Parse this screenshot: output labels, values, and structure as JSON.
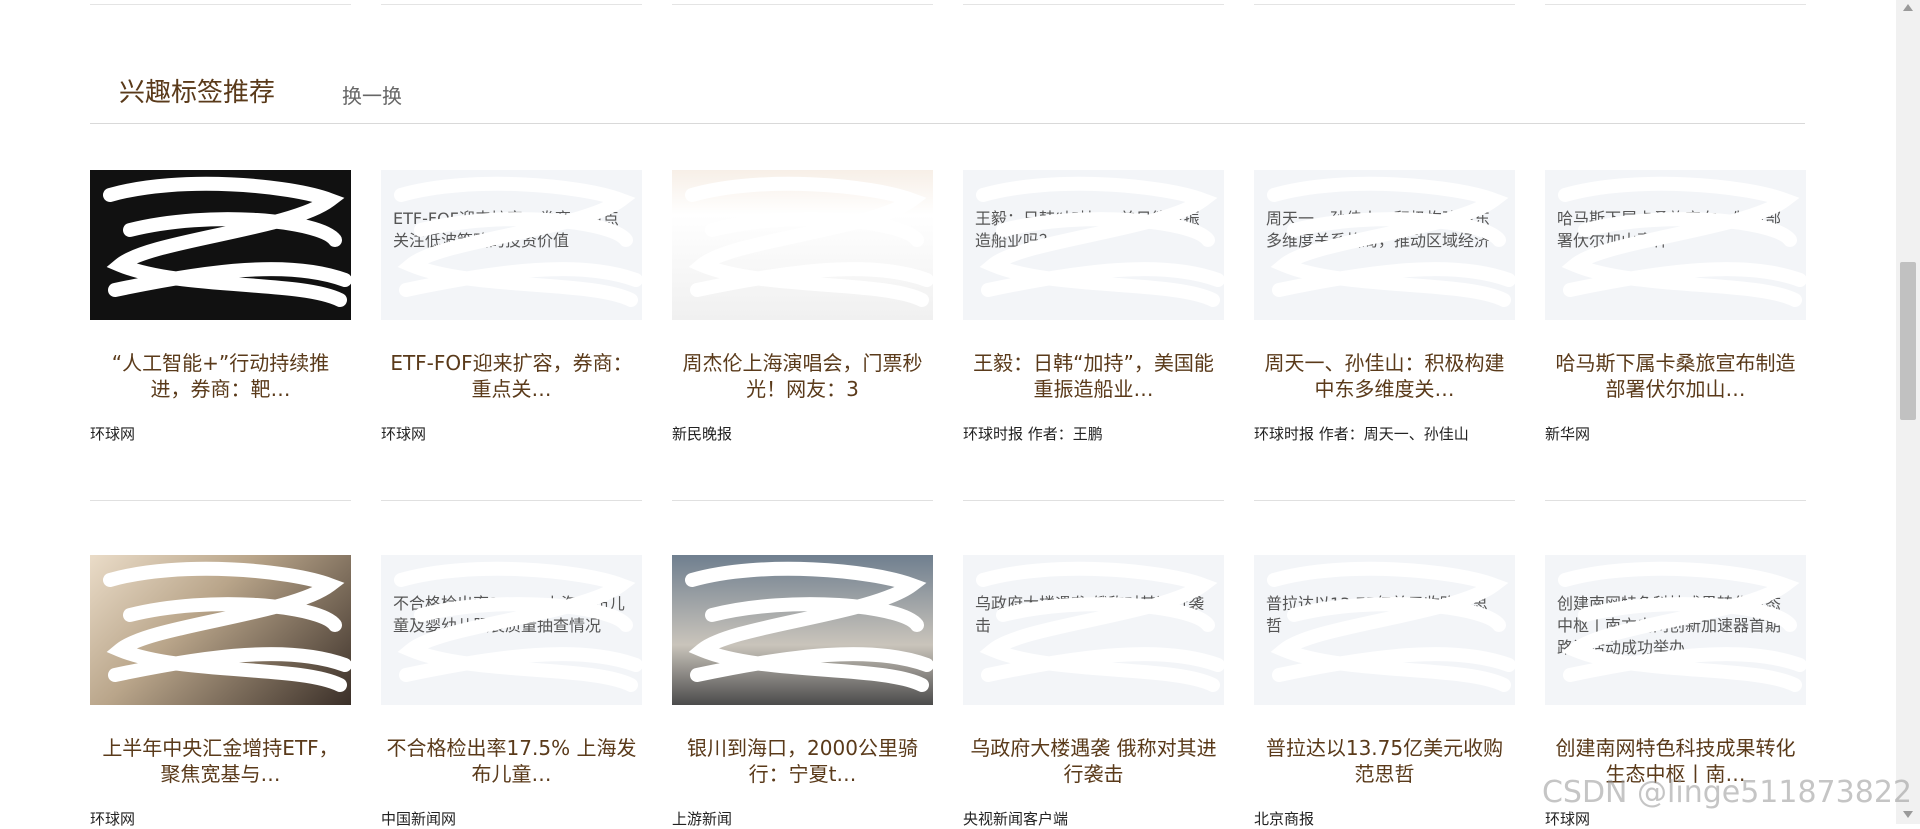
{
  "section": {
    "title": "兴趣标签推荐",
    "refresh_label": "换一换"
  },
  "row1": [
    {
      "thumb_type": "chart",
      "thumb_text": "",
      "title": "“人工智能+”行动持续推进，券商：靶…",
      "source": "环球网"
    },
    {
      "thumb_type": "text",
      "thumb_text": "ETF-FOF迎来扩容，券商：重点关注低波策略的投资价值",
      "title": "ETF-FOF迎来扩容，券商：重点关…",
      "source": "环球网"
    },
    {
      "thumb_type": "app",
      "thumb_text": "",
      "title": "周杰伦上海演唱会，门票秒光！网友：3",
      "source": "新民晚报"
    },
    {
      "thumb_type": "text",
      "thumb_text": "王毅：日韩“加持”，美日能重振造船业吗？",
      "title": "王毅：日韩“加持”，美国能重振造船业…",
      "source": "环球时报 作者：王鹏"
    },
    {
      "thumb_type": "text",
      "thumb_text": "周天一、孙佳山：积极构建中东多维度关系格局，推动区域经济",
      "title": "周天一、孙佳山：积极构建中东多维度关…",
      "source": "环球时报 作者：周天一、孙佳山"
    },
    {
      "thumb_type": "text",
      "thumb_text": "哈马斯下属卡桑旅宣布：制造部署伏尔加山事件",
      "title": "哈马斯下属卡桑旅宣布制造部署伏尔加山…",
      "source": "新华网"
    }
  ],
  "row2": [
    {
      "thumb_type": "photo-a",
      "thumb_text": "",
      "title": "上半年中央汇金增持ETF，聚焦宽基与…",
      "source": "环球网"
    },
    {
      "thumb_type": "text",
      "thumb_text": "不合格检出率17.5% 上海发布儿童及婴幼儿服装质量抽查情况",
      "title": "不合格检出率17.5% 上海发布儿童…",
      "source": "中国新闻网"
    },
    {
      "thumb_type": "photo-b",
      "thumb_text": "",
      "title": "银川到海口，2000公里骑行：宁夏t…",
      "source": "上游新闻"
    },
    {
      "thumb_type": "text",
      "thumb_text": "乌政府大楼遇袭 俄称对其进行袭击",
      "title": "乌政府大楼遇袭 俄称对其进行袭击",
      "source": "央视新闻客户端"
    },
    {
      "thumb_type": "text",
      "thumb_text": "普拉达以13.75亿美元收购范思哲",
      "title": "普拉达以13.75亿美元收购范思哲",
      "source": "北京商报"
    },
    {
      "thumb_type": "text",
      "thumb_text": "创建南网特色科技成果转化生态中枢丨南方电网创新加速器首期路演活动成功举办",
      "title": "创建南网特色科技成果转化生态中枢丨南…",
      "source": "环球网"
    }
  ],
  "watermark": "CSDN @linge511873822"
}
